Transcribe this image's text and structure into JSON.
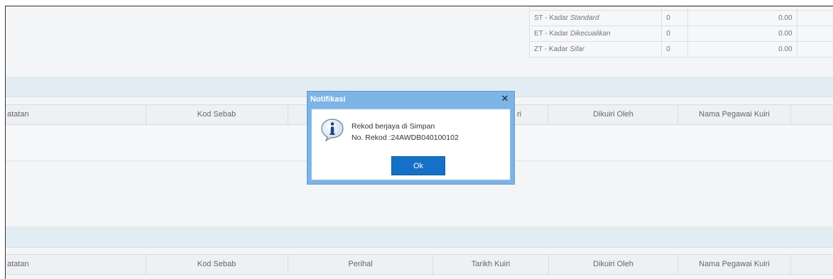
{
  "gst_rates": [
    {
      "label": "ST - Kadar ",
      "label_em": "Standard",
      "count": "0",
      "amount": "0.00"
    },
    {
      "label": "ET - Kadar ",
      "label_em": "Dikecualikan",
      "count": "0",
      "amount": "0.00"
    },
    {
      "label": "ZT - Kadar ",
      "label_em": "Sifar",
      "count": "0",
      "amount": "0.00"
    }
  ],
  "partial_top_row": {
    "amount": "0.00"
  },
  "query_table_1": {
    "columns": [
      "atatan",
      "Kod Sebab",
      "",
      "ri",
      "Dikuiri Oleh",
      "Nama Pegawai Kuiri",
      ""
    ]
  },
  "query_table_2": {
    "columns": [
      "atatan",
      "Kod Sebab",
      "Perihal",
      "Tarikh Kuiri",
      "Dikuiri Oleh",
      "Nama Pegawai Kuiri",
      ""
    ]
  },
  "dialog": {
    "title": "Notifikasi",
    "close_symbol": "✕",
    "icon": "info-icon",
    "message_line1": "Rekod berjaya di Simpan",
    "message_line2": "No. Rekod :24AWDB040100102",
    "ok_label": "Ok"
  }
}
